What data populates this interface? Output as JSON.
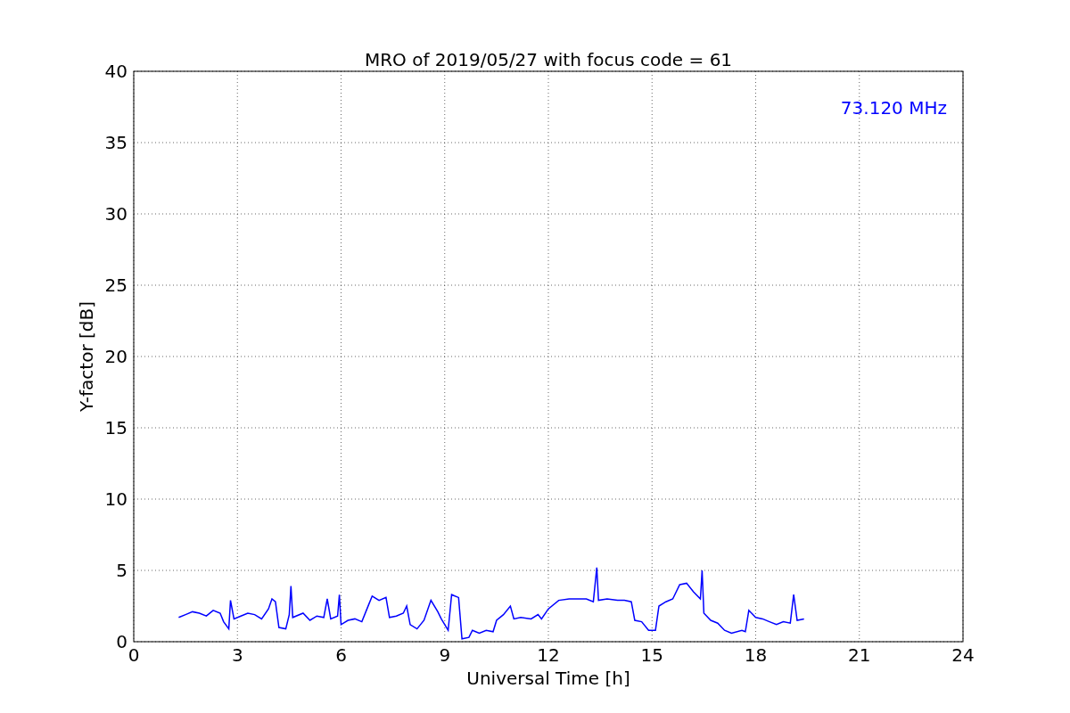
{
  "figure": {
    "chart_data": {
      "type": "line",
      "title": "MRO of 2019/05/27 with focus code = 61",
      "xlabel": "Universal Time [h]",
      "ylabel": "Y-factor [dB]",
      "x": [
        1.3,
        1.5,
        1.7,
        1.9,
        2.1,
        2.3,
        2.5,
        2.6,
        2.75,
        2.8,
        2.9,
        3.1,
        3.3,
        3.5,
        3.7,
        3.9,
        4.0,
        4.1,
        4.2,
        4.4,
        4.5,
        4.55,
        4.6,
        4.9,
        5.1,
        5.3,
        5.5,
        5.6,
        5.7,
        5.9,
        5.95,
        6.0,
        6.2,
        6.4,
        6.6,
        6.8,
        6.9,
        7.1,
        7.3,
        7.4,
        7.6,
        7.8,
        7.9,
        8.0,
        8.2,
        8.4,
        8.6,
        8.8,
        8.9,
        9.1,
        9.2,
        9.4,
        9.5,
        9.7,
        9.8,
        10.0,
        10.2,
        10.4,
        10.5,
        10.7,
        10.9,
        11.0,
        11.2,
        11.5,
        11.7,
        11.8,
        12.0,
        12.3,
        12.6,
        12.9,
        13.1,
        13.3,
        13.4,
        13.45,
        13.7,
        14.0,
        14.2,
        14.4,
        14.5,
        14.7,
        14.9,
        15.1,
        15.2,
        15.4,
        15.6,
        15.8,
        16.0,
        16.2,
        16.4,
        16.45,
        16.5,
        16.7,
        16.9,
        17.1,
        17.3,
        17.6,
        17.7,
        17.8,
        18.0,
        18.2,
        18.4,
        18.6,
        18.8,
        19.0,
        19.1,
        19.2,
        19.4
      ],
      "series": [
        {
          "name": "73.120 MHz",
          "color": "#0000ff",
          "values": [
            1.7,
            1.9,
            2.1,
            2.0,
            1.8,
            2.2,
            2.0,
            1.4,
            0.9,
            2.9,
            1.6,
            1.8,
            2.0,
            1.9,
            1.6,
            2.3,
            3.0,
            2.8,
            1.0,
            0.9,
            1.9,
            3.9,
            1.7,
            2.0,
            1.5,
            1.8,
            1.7,
            3.0,
            1.6,
            1.8,
            3.3,
            1.2,
            1.5,
            1.6,
            1.4,
            2.6,
            3.2,
            2.9,
            3.1,
            1.7,
            1.8,
            2.0,
            2.5,
            1.2,
            0.9,
            1.5,
            2.9,
            2.1,
            1.6,
            0.8,
            3.3,
            3.1,
            0.2,
            0.3,
            0.8,
            0.6,
            0.8,
            0.7,
            1.5,
            1.9,
            2.5,
            1.6,
            1.7,
            1.6,
            1.9,
            1.6,
            2.3,
            2.9,
            3.0,
            3.0,
            3.0,
            2.8,
            5.2,
            2.9,
            3.0,
            2.9,
            2.9,
            2.8,
            1.5,
            1.4,
            0.8,
            0.8,
            2.5,
            2.8,
            3.0,
            4.0,
            4.1,
            3.5,
            3.0,
            5.0,
            2.0,
            1.5,
            1.3,
            0.8,
            0.6,
            0.8,
            0.7,
            2.2,
            1.7,
            1.6,
            1.4,
            1.2,
            1.4,
            1.3,
            3.3,
            1.5,
            1.6
          ]
        }
      ],
      "xlim": [
        0,
        24
      ],
      "ylim": [
        0,
        40
      ],
      "xticks": [
        0,
        3,
        6,
        9,
        12,
        15,
        18,
        21,
        24
      ],
      "yticks": [
        0,
        5,
        10,
        15,
        20,
        25,
        30,
        35,
        40
      ],
      "grid": true
    }
  }
}
